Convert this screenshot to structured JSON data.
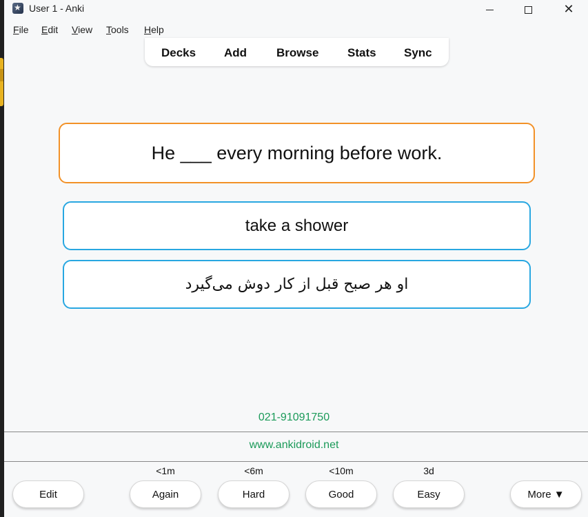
{
  "window": {
    "title": "User 1 - Anki",
    "minimize_icon": "minimize-icon",
    "maximize_icon": "maximize-icon",
    "close_icon": "close-icon"
  },
  "menu": {
    "items": [
      {
        "hot": "F",
        "rest": "ile"
      },
      {
        "hot": "E",
        "rest": "dit"
      },
      {
        "hot": "V",
        "rest": "iew"
      },
      {
        "hot": "T",
        "rest": "ools"
      },
      {
        "hot": "H",
        "rest": "elp"
      }
    ]
  },
  "toolbar": {
    "items": [
      "Decks",
      "Add",
      "Browse",
      "Stats",
      "Sync"
    ]
  },
  "card": {
    "question": "He ___ every morning before work.",
    "answer": "take a shower",
    "translation": "او هر صبح قبل از کار دوش می‌گیرد"
  },
  "footer": {
    "phone": "021-91091750",
    "website": "www.ankidroid.net"
  },
  "review": {
    "edit_label": "Edit",
    "more_label": "More ▼",
    "intervals": [
      "<1m",
      "<6m",
      "<10m",
      "3d"
    ],
    "answers": [
      "Again",
      "Hard",
      "Good",
      "Easy"
    ]
  },
  "colors": {
    "question_border": "#f29127",
    "answer_border": "#28a7e1",
    "footer_text": "#1b9a59"
  }
}
